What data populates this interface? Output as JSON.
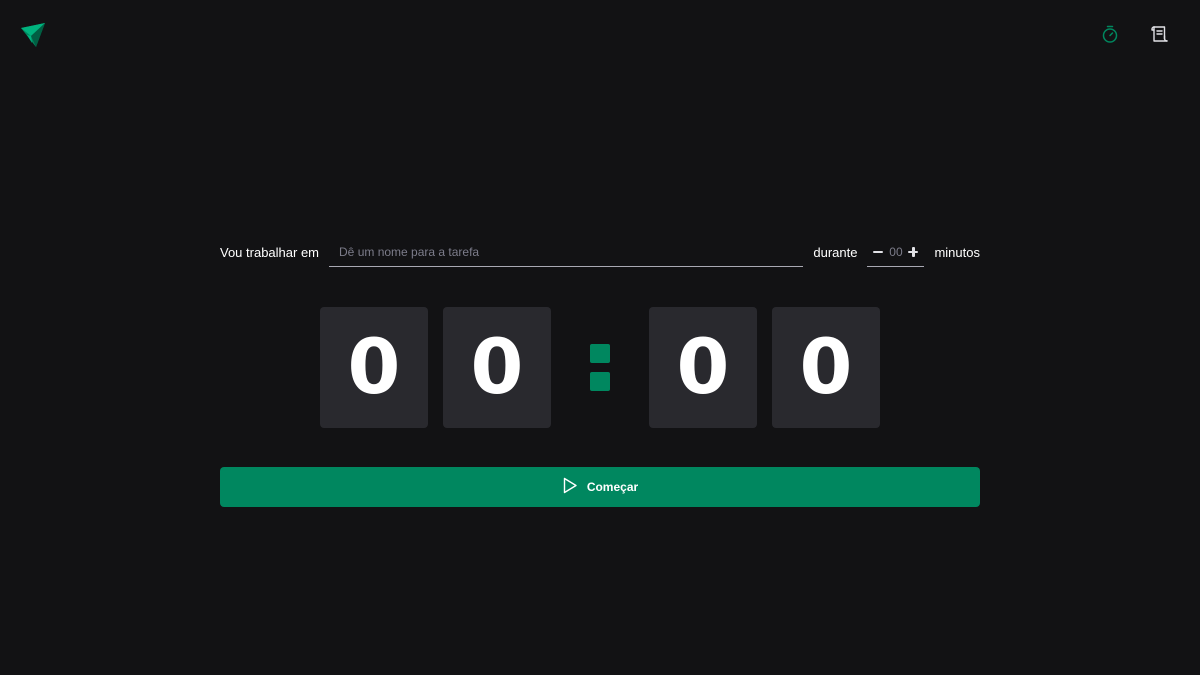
{
  "header": {
    "logo_icon": "paper-plane-logo-icon",
    "nav": [
      {
        "icon": "timer-icon",
        "active": true
      },
      {
        "icon": "scroll-icon",
        "active": false
      }
    ]
  },
  "form": {
    "task_label": "Vou trabalhar em",
    "task_placeholder": "Dê um nome para a tarefa",
    "task_value": "",
    "duration_label": "durante",
    "minutes_placeholder": "00",
    "minutes_unit": "minutos",
    "minus_icon": "minus-icon",
    "plus_icon": "plus-icon"
  },
  "countdown": {
    "digits": [
      "0",
      "0",
      "0",
      "0"
    ],
    "separator": ":"
  },
  "start_button": {
    "label": "Começar",
    "icon": "play-icon"
  },
  "colors": {
    "background": "#121214",
    "accent": "#00875f",
    "digit_bg": "#29292e",
    "text": "#e1e1e6",
    "placeholder": "#7c7c8a"
  }
}
